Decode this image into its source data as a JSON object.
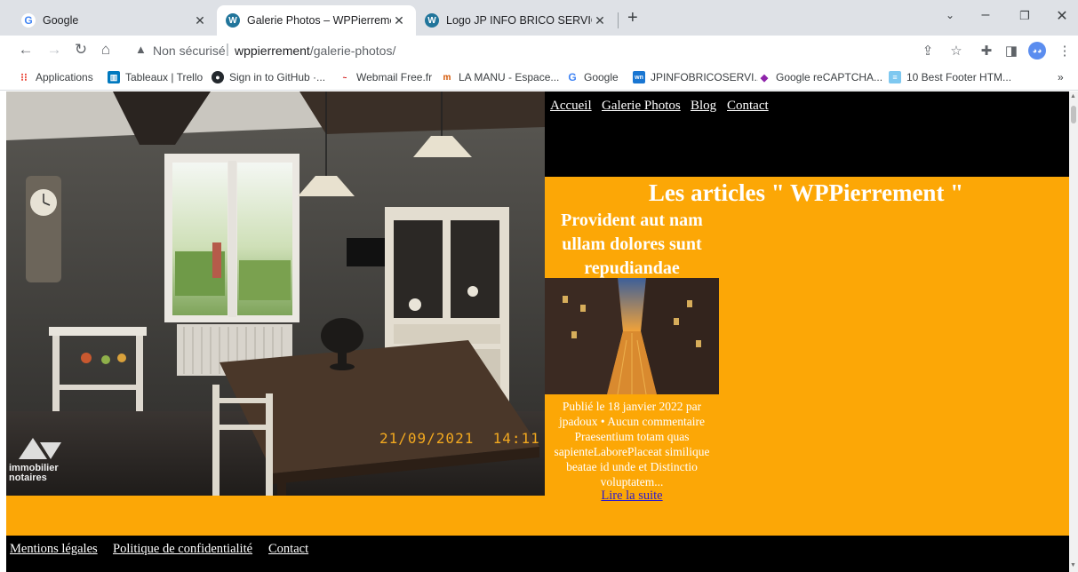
{
  "browser": {
    "tabs": [
      {
        "title": "Google",
        "icon": "google-icon"
      },
      {
        "title": "Galerie Photos – WPPierrement",
        "icon": "wordpress-icon"
      },
      {
        "title": "Logo JP INFO BRICO SERVICES.p",
        "icon": "wordpress-icon"
      }
    ],
    "address": {
      "security": "Non sécurisé",
      "url_host": "wppierrement",
      "url_path": "/galerie-photos/"
    },
    "bookmarks": [
      "Applications",
      "Tableaux | Trello",
      "Sign in to GitHub ·...",
      "Webmail Free.fr",
      "LA MANU - Espace...",
      "Google",
      "JPINFOBRICOSERVI...",
      "Google reCAPTCHA...",
      "10 Best Footer HTM..."
    ],
    "bookmarks_more": "»"
  },
  "nav": {
    "items": [
      "Accueil",
      "Galerie Photos",
      "Blog",
      "Contact"
    ]
  },
  "hero": {
    "timestamp": "21/09/2021  14:11",
    "logo_text_1": "immobilier",
    "logo_text_2": "notaires"
  },
  "section": {
    "title": "Les articles \" WPPierrement \""
  },
  "post": {
    "title": "Provident aut nam ullam dolores sunt repudiandae",
    "meta": "Publié le 18 janvier 2022 par jpadoux • Aucun commentaire",
    "excerpt": "Praesentium totam quas sapienteLaborePlaceat similique beatae id unde et Distinctio voluptatem...",
    "read_more": "Lire la suite"
  },
  "footer": {
    "links": [
      "Mentions légales",
      "Politique de confidentialité",
      "Contact"
    ]
  },
  "colors": {
    "orange": "#fca706",
    "black": "#000000",
    "link_blue": "#2e1bcc"
  }
}
